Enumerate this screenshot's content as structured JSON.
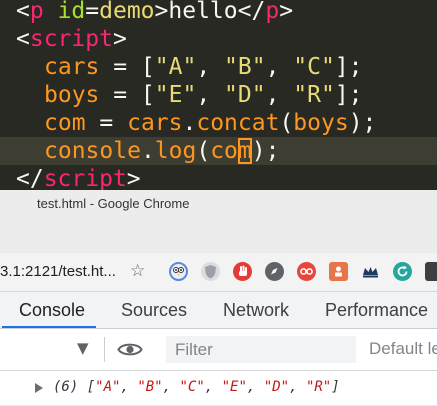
{
  "editor": {
    "line1": {
      "open_lt": "<",
      "tag": "p",
      "attr": "id",
      "eq": "=",
      "attr_value": "demo",
      "gt": ">",
      "text": "hello",
      "close_lt": "</",
      "close_tag": "p",
      "close_gt": ">"
    },
    "line2": {
      "lt": "<",
      "tag": "script",
      "gt": ">"
    },
    "line3": {
      "var": "cars",
      "assign": " = [",
      "items": [
        "\"A\"",
        "\"B\"",
        "\"C\""
      ],
      "sep": ", ",
      "end": "];"
    },
    "line4": {
      "var": "boys",
      "assign": " = [",
      "items": [
        "\"E\"",
        "\"D\"",
        "\"R\""
      ],
      "sep": ", ",
      "end": "];"
    },
    "line5": {
      "var": "com",
      "assign": " = ",
      "obj": "cars",
      "dot": ".",
      "method": "concat",
      "open": "(",
      "arg": "boys",
      "close": ");"
    },
    "line6": {
      "obj": "console",
      "dot": ".",
      "method": "log",
      "open": "(",
      "arg_a": "co",
      "arg_cursor": "m",
      "close": ");"
    },
    "line7": {
      "lt": "</",
      "tag": "script",
      "gt": ">"
    }
  },
  "window": {
    "title": "test.html - Google Chrome"
  },
  "address_bar": {
    "url": "3.1:2121/test.ht..."
  },
  "extensions": [
    {
      "icon": "owl-icon",
      "color": "#5a8ad6"
    },
    {
      "icon": "shield-icon",
      "color": "#9aa0a6"
    },
    {
      "icon": "hand-stop-icon",
      "color": "#e53935"
    },
    {
      "icon": "compass-icon",
      "color": "#5f6368"
    },
    {
      "icon": "infinity-icon",
      "color": "#e8453c"
    },
    {
      "icon": "tag-icon",
      "color": "#e8744a"
    },
    {
      "icon": "crown-icon",
      "color": "#1f3a5f"
    },
    {
      "icon": "refresh-icon",
      "color": "#26a69a"
    },
    {
      "icon": "extension-icon",
      "color": "#3c4043"
    }
  ],
  "devtools": {
    "tabs": [
      {
        "label": "Console",
        "active": true
      },
      {
        "label": "Sources",
        "active": false
      },
      {
        "label": "Network",
        "active": false
      },
      {
        "label": "Performance",
        "active": false
      }
    ],
    "filter_placeholder": "Filter",
    "levels_label": "Default le",
    "accent": "#1a73e8"
  },
  "console_output": {
    "prefix": "(6) [",
    "items": [
      "\"A\"",
      "\"B\"",
      "\"C\"",
      "\"E\"",
      "\"D\"",
      "\"R\""
    ],
    "suffix": "]"
  }
}
